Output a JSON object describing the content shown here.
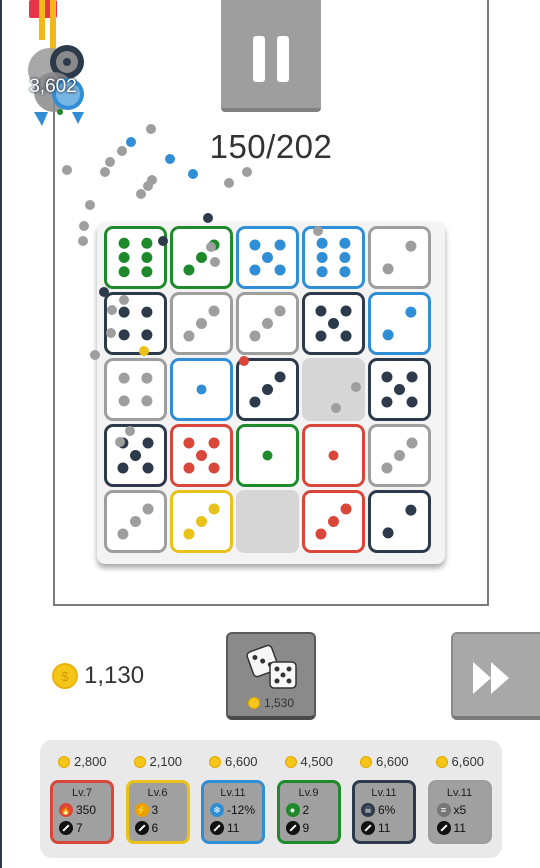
{
  "game": {
    "wave_counter": "150/202",
    "boss_hp": "3,602",
    "coins": "1,130",
    "summon_cost": "1,530"
  },
  "colors": {
    "green": "#1f8a2b",
    "yellow": "#e8c21a",
    "blue": "#2f8ed6",
    "navy": "#2d3a4b",
    "red": "#d9463a",
    "gray": "#9e9e9e"
  },
  "board": {
    "rows": [
      [
        {
          "color": "green",
          "pips": 6
        },
        {
          "color": "green",
          "pips": 3
        },
        {
          "color": "blue",
          "pips": 5
        },
        {
          "color": "blue",
          "pips": 6
        },
        {
          "color": "gray",
          "pips": 2
        }
      ],
      [
        {
          "color": "navy",
          "pips": 4
        },
        {
          "color": "gray",
          "pips": 3
        },
        {
          "color": "gray",
          "pips": 3
        },
        {
          "color": "navy",
          "pips": 5
        },
        {
          "color": "blue",
          "pips": 2
        }
      ],
      [
        {
          "color": "gray",
          "pips": 4
        },
        {
          "color": "blue",
          "pips": 1
        },
        {
          "color": "navy",
          "pips": 3
        },
        {
          "color": "empty",
          "pips": 0
        },
        {
          "color": "navy",
          "pips": 5
        }
      ],
      [
        {
          "color": "navy",
          "pips": 5
        },
        {
          "color": "red",
          "pips": 5
        },
        {
          "color": "green",
          "pips": 1
        },
        {
          "color": "red",
          "pips": 1
        },
        {
          "color": "gray",
          "pips": 3
        }
      ],
      [
        {
          "color": "gray",
          "pips": 3
        },
        {
          "color": "yellow",
          "pips": 3
        },
        {
          "color": "empty",
          "pips": 0
        },
        {
          "color": "red",
          "pips": 3
        },
        {
          "color": "navy",
          "pips": 2
        }
      ]
    ]
  },
  "upgrades": [
    {
      "price": "2,800",
      "level": "Lv.7",
      "stat_icon": "fire-icon",
      "stat": "350",
      "power": "7",
      "color": "red"
    },
    {
      "price": "2,100",
      "level": "Lv.6",
      "stat_icon": "lightning-icon",
      "stat": "3",
      "power": "6",
      "color": "yellow"
    },
    {
      "price": "6,600",
      "level": "Lv.11",
      "stat_icon": "snowflake-icon",
      "stat": "-12%",
      "power": "11",
      "color": "blue"
    },
    {
      "price": "4,500",
      "level": "Lv.9",
      "stat_icon": "poison-icon",
      "stat": "2",
      "power": "9",
      "color": "green"
    },
    {
      "price": "6,600",
      "level": "Lv.11",
      "stat_icon": "skull-icon",
      "stat": "6%",
      "power": "11",
      "color": "navy"
    },
    {
      "price": "6,600",
      "level": "Lv.11",
      "stat_icon": "multishot-icon",
      "stat": "x5",
      "power": "11",
      "color": "gray"
    }
  ]
}
